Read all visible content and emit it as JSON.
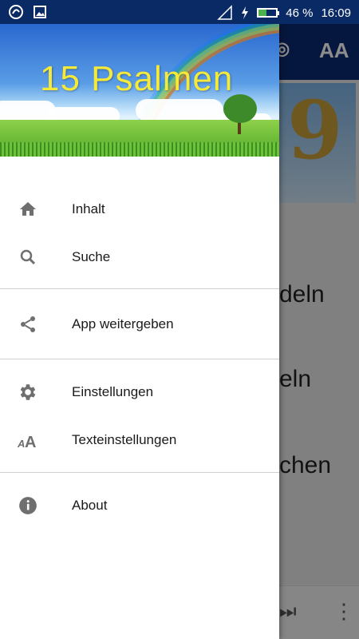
{
  "statusbar": {
    "battery_percent": "46 %",
    "time": "16:09",
    "battery_level": 0.46
  },
  "background": {
    "texts": [
      "deln",
      "eln",
      "chen"
    ]
  },
  "drawer": {
    "title": "15 Psalmen",
    "groups": [
      [
        {
          "label": "Inhalt",
          "icon": "home-icon"
        },
        {
          "label": "Suche",
          "icon": "search-icon"
        }
      ],
      [
        {
          "label": "App weitergeben",
          "icon": "share-icon"
        }
      ],
      [
        {
          "label": "Einstellungen",
          "icon": "gear-icon"
        },
        {
          "label": "Texteinstellungen",
          "icon": "text-size-icon"
        }
      ],
      [
        {
          "label": "About",
          "icon": "info-icon"
        }
      ]
    ]
  }
}
